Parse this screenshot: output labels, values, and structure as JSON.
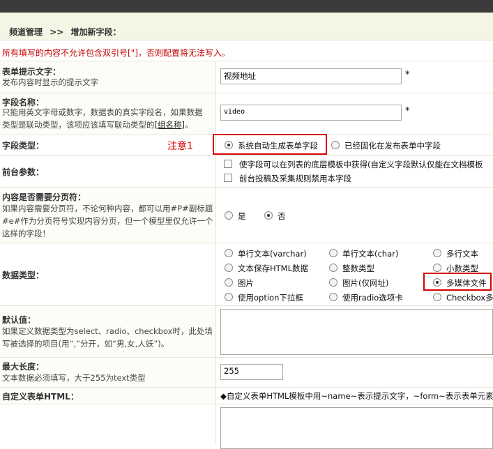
{
  "breadcrumb": {
    "section": "频道管理",
    "sep": ">>",
    "page": "增加新字段："
  },
  "warning": "所有填写的内容不允许包含双引号[\"]，否则配置将无法写入。",
  "form": {
    "prompt": {
      "title": "表单提示文字：",
      "desc": "发布内容时显示的提示文字",
      "value": "视频地址",
      "required": "*"
    },
    "field_name": {
      "title": "字段名称：",
      "desc_line1": "只能用英文字母或数字，数据表的真实字段名，如果数据",
      "desc_line2": "类型是联动类型，该项应该填写联动类型的",
      "desc_link": "[组名称]",
      "desc_end": "。",
      "value": "video",
      "required": "*"
    },
    "field_type": {
      "title": "字段类型：",
      "note": "注意1",
      "options": [
        "系统自动生成表单字段",
        "已经固化在发布表单中字段"
      ],
      "selected": 0
    },
    "front_params": {
      "title": "前台参数：",
      "options": [
        "使字段可以在列表的底层模板中获得(自定义字段默认仅能在文档模板",
        "前台投稿及采集规则禁用本字段"
      ]
    },
    "pagination": {
      "title": "内容是否需要分页符：",
      "desc_line1": "如果内容需要分页符，不论何种内容，都可以用#P#副标题",
      "desc_line2": "#e#作为分页符号实现内容分页，但一个模型里仅允许一个",
      "desc_line3": "这样的字段！",
      "options": [
        "是",
        "否"
      ],
      "selected": 1
    },
    "data_type": {
      "title": "数据类型：",
      "options": [
        "单行文本(varchar)",
        "单行文本(char)",
        "多行文本",
        "文本保存HTML数据",
        "整数类型",
        "小数类型",
        "图片",
        "图片(仅网址)",
        "多媒体文件",
        "使用option下拉框",
        "使用radio选项卡",
        "Checkbox多选"
      ],
      "selected": 8
    },
    "default_value": {
      "title": "默认值：",
      "desc_line1": "如果定义数据类型为select、radio、checkbox时，此处填",
      "desc_line2": "写被选择的项目(用“,”分开，如“男,女,人妖”)。"
    },
    "max_length": {
      "title": "最大长度：",
      "desc": "文本数据必须填写，大于255为text类型",
      "value": "255"
    },
    "custom_html": {
      "title": "自定义表单HTML：",
      "hint": "◆自定义表单HTML模板中用~name~表示提示文字，~form~表示表单元素。"
    }
  }
}
